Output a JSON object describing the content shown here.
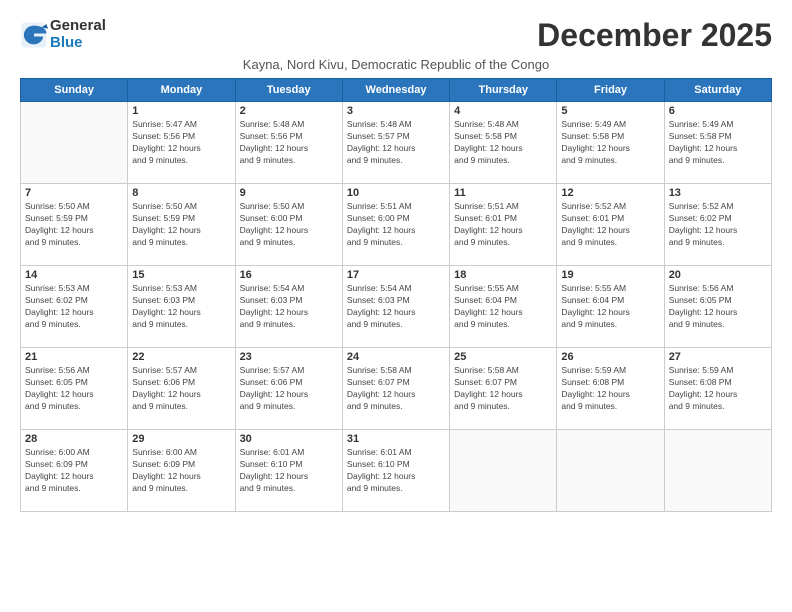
{
  "logo": {
    "general": "General",
    "blue": "Blue"
  },
  "title": "December 2025",
  "subtitle": "Kayna, Nord Kivu, Democratic Republic of the Congo",
  "headers": [
    "Sunday",
    "Monday",
    "Tuesday",
    "Wednesday",
    "Thursday",
    "Friday",
    "Saturday"
  ],
  "weeks": [
    [
      {
        "day": "",
        "info": ""
      },
      {
        "day": "1",
        "info": "Sunrise: 5:47 AM\nSunset: 5:56 PM\nDaylight: 12 hours\nand 9 minutes."
      },
      {
        "day": "2",
        "info": "Sunrise: 5:48 AM\nSunset: 5:56 PM\nDaylight: 12 hours\nand 9 minutes."
      },
      {
        "day": "3",
        "info": "Sunrise: 5:48 AM\nSunset: 5:57 PM\nDaylight: 12 hours\nand 9 minutes."
      },
      {
        "day": "4",
        "info": "Sunrise: 5:48 AM\nSunset: 5:58 PM\nDaylight: 12 hours\nand 9 minutes."
      },
      {
        "day": "5",
        "info": "Sunrise: 5:49 AM\nSunset: 5:58 PM\nDaylight: 12 hours\nand 9 minutes."
      },
      {
        "day": "6",
        "info": "Sunrise: 5:49 AM\nSunset: 5:58 PM\nDaylight: 12 hours\nand 9 minutes."
      }
    ],
    [
      {
        "day": "7",
        "info": "Sunrise: 5:50 AM\nSunset: 5:59 PM\nDaylight: 12 hours\nand 9 minutes."
      },
      {
        "day": "8",
        "info": "Sunrise: 5:50 AM\nSunset: 5:59 PM\nDaylight: 12 hours\nand 9 minutes."
      },
      {
        "day": "9",
        "info": "Sunrise: 5:50 AM\nSunset: 6:00 PM\nDaylight: 12 hours\nand 9 minutes."
      },
      {
        "day": "10",
        "info": "Sunrise: 5:51 AM\nSunset: 6:00 PM\nDaylight: 12 hours\nand 9 minutes."
      },
      {
        "day": "11",
        "info": "Sunrise: 5:51 AM\nSunset: 6:01 PM\nDaylight: 12 hours\nand 9 minutes."
      },
      {
        "day": "12",
        "info": "Sunrise: 5:52 AM\nSunset: 6:01 PM\nDaylight: 12 hours\nand 9 minutes."
      },
      {
        "day": "13",
        "info": "Sunrise: 5:52 AM\nSunset: 6:02 PM\nDaylight: 12 hours\nand 9 minutes."
      }
    ],
    [
      {
        "day": "14",
        "info": "Sunrise: 5:53 AM\nSunset: 6:02 PM\nDaylight: 12 hours\nand 9 minutes."
      },
      {
        "day": "15",
        "info": "Sunrise: 5:53 AM\nSunset: 6:03 PM\nDaylight: 12 hours\nand 9 minutes."
      },
      {
        "day": "16",
        "info": "Sunrise: 5:54 AM\nSunset: 6:03 PM\nDaylight: 12 hours\nand 9 minutes."
      },
      {
        "day": "17",
        "info": "Sunrise: 5:54 AM\nSunset: 6:03 PM\nDaylight: 12 hours\nand 9 minutes."
      },
      {
        "day": "18",
        "info": "Sunrise: 5:55 AM\nSunset: 6:04 PM\nDaylight: 12 hours\nand 9 minutes."
      },
      {
        "day": "19",
        "info": "Sunrise: 5:55 AM\nSunset: 6:04 PM\nDaylight: 12 hours\nand 9 minutes."
      },
      {
        "day": "20",
        "info": "Sunrise: 5:56 AM\nSunset: 6:05 PM\nDaylight: 12 hours\nand 9 minutes."
      }
    ],
    [
      {
        "day": "21",
        "info": "Sunrise: 5:56 AM\nSunset: 6:05 PM\nDaylight: 12 hours\nand 9 minutes."
      },
      {
        "day": "22",
        "info": "Sunrise: 5:57 AM\nSunset: 6:06 PM\nDaylight: 12 hours\nand 9 minutes."
      },
      {
        "day": "23",
        "info": "Sunrise: 5:57 AM\nSunset: 6:06 PM\nDaylight: 12 hours\nand 9 minutes."
      },
      {
        "day": "24",
        "info": "Sunrise: 5:58 AM\nSunset: 6:07 PM\nDaylight: 12 hours\nand 9 minutes."
      },
      {
        "day": "25",
        "info": "Sunrise: 5:58 AM\nSunset: 6:07 PM\nDaylight: 12 hours\nand 9 minutes."
      },
      {
        "day": "26",
        "info": "Sunrise: 5:59 AM\nSunset: 6:08 PM\nDaylight: 12 hours\nand 9 minutes."
      },
      {
        "day": "27",
        "info": "Sunrise: 5:59 AM\nSunset: 6:08 PM\nDaylight: 12 hours\nand 9 minutes."
      }
    ],
    [
      {
        "day": "28",
        "info": "Sunrise: 6:00 AM\nSunset: 6:09 PM\nDaylight: 12 hours\nand 9 minutes."
      },
      {
        "day": "29",
        "info": "Sunrise: 6:00 AM\nSunset: 6:09 PM\nDaylight: 12 hours\nand 9 minutes."
      },
      {
        "day": "30",
        "info": "Sunrise: 6:01 AM\nSunset: 6:10 PM\nDaylight: 12 hours\nand 9 minutes."
      },
      {
        "day": "31",
        "info": "Sunrise: 6:01 AM\nSunset: 6:10 PM\nDaylight: 12 hours\nand 9 minutes."
      },
      {
        "day": "",
        "info": ""
      },
      {
        "day": "",
        "info": ""
      },
      {
        "day": "",
        "info": ""
      }
    ]
  ]
}
